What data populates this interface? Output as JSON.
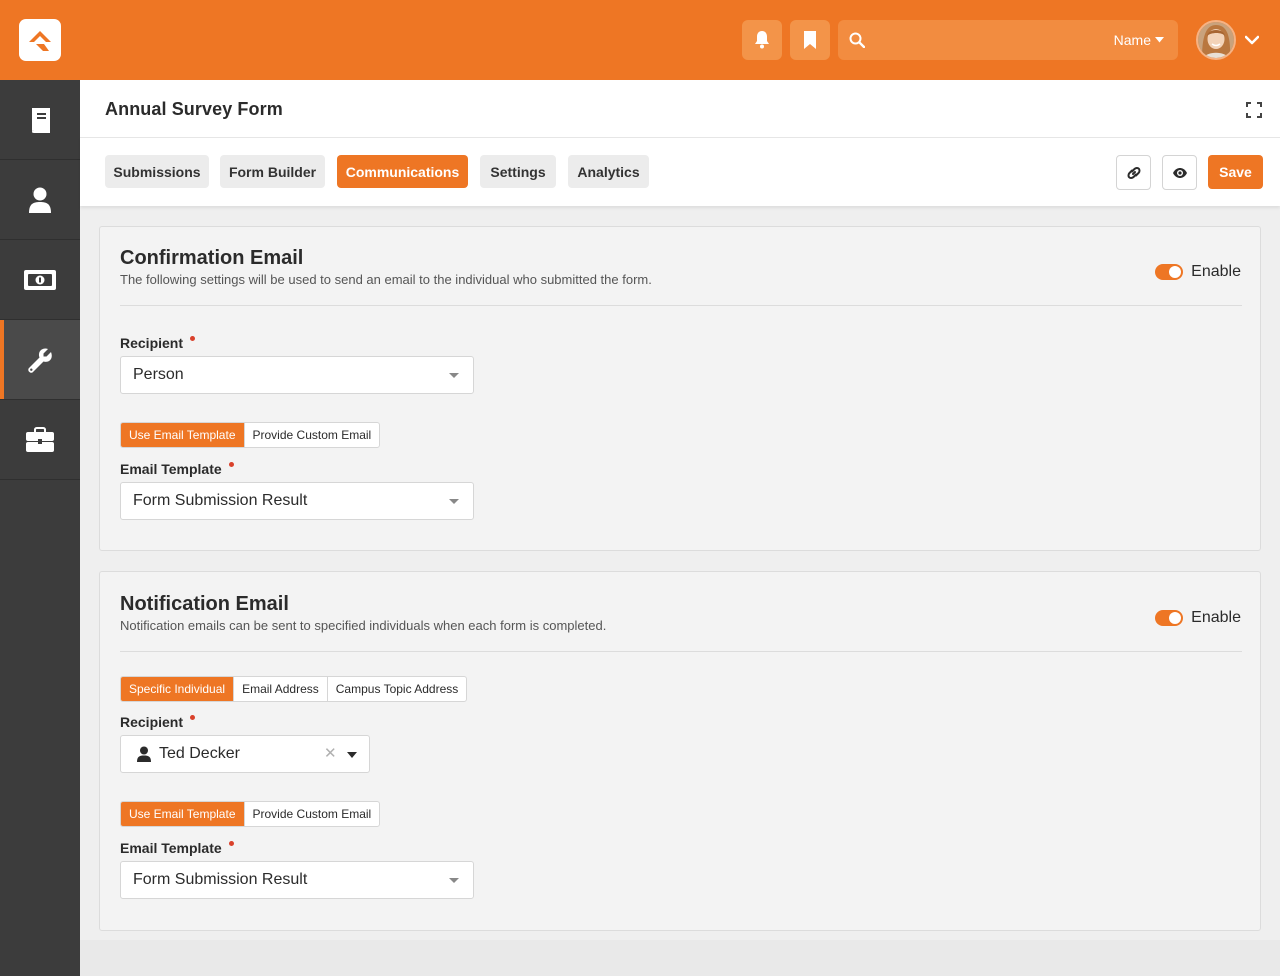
{
  "topbar": {
    "search_placeholder": "",
    "search_scope_label": "Name",
    "brand_color": "#ee7624"
  },
  "sidebar": {
    "items": [
      {
        "icon": "book-icon",
        "active": false
      },
      {
        "icon": "person-icon",
        "active": false
      },
      {
        "icon": "money-icon",
        "active": false
      },
      {
        "icon": "wrench-icon",
        "active": true
      },
      {
        "icon": "briefcase-icon",
        "active": false
      }
    ]
  },
  "page": {
    "title": "Annual Survey Form"
  },
  "tabs": [
    {
      "label": "Submissions",
      "active": false
    },
    {
      "label": "Form Builder",
      "active": false
    },
    {
      "label": "Communications",
      "active": true
    },
    {
      "label": "Settings",
      "active": false
    },
    {
      "label": "Analytics",
      "active": false
    }
  ],
  "toolbar": {
    "save_label": "Save",
    "link_icon": "link-icon",
    "preview_icon": "eye-icon"
  },
  "confirmation": {
    "title": "Confirmation Email",
    "description": "The following settings will be used to send an email to the individual who submitted the form.",
    "enable_label": "Enable",
    "enabled": true,
    "recipient_label": "Recipient",
    "recipient_value": "Person",
    "source_options": [
      "Use Email Template",
      "Provide Custom Email"
    ],
    "source_selected": "Use Email Template",
    "template_label": "Email Template",
    "template_value": "Form Submission Result"
  },
  "notification": {
    "title": "Notification Email",
    "description": "Notification emails can be sent to specified individuals when each form is completed.",
    "enable_label": "Enable",
    "enabled": true,
    "destination_options": [
      "Specific Individual",
      "Email Address",
      "Campus Topic Address"
    ],
    "destination_selected": "Specific Individual",
    "recipient_label": "Recipient",
    "recipient_value": "Ted Decker",
    "source_options": [
      "Use Email Template",
      "Provide Custom Email"
    ],
    "source_selected": "Use Email Template",
    "template_label": "Email Template",
    "template_value": "Form Submission Result"
  }
}
